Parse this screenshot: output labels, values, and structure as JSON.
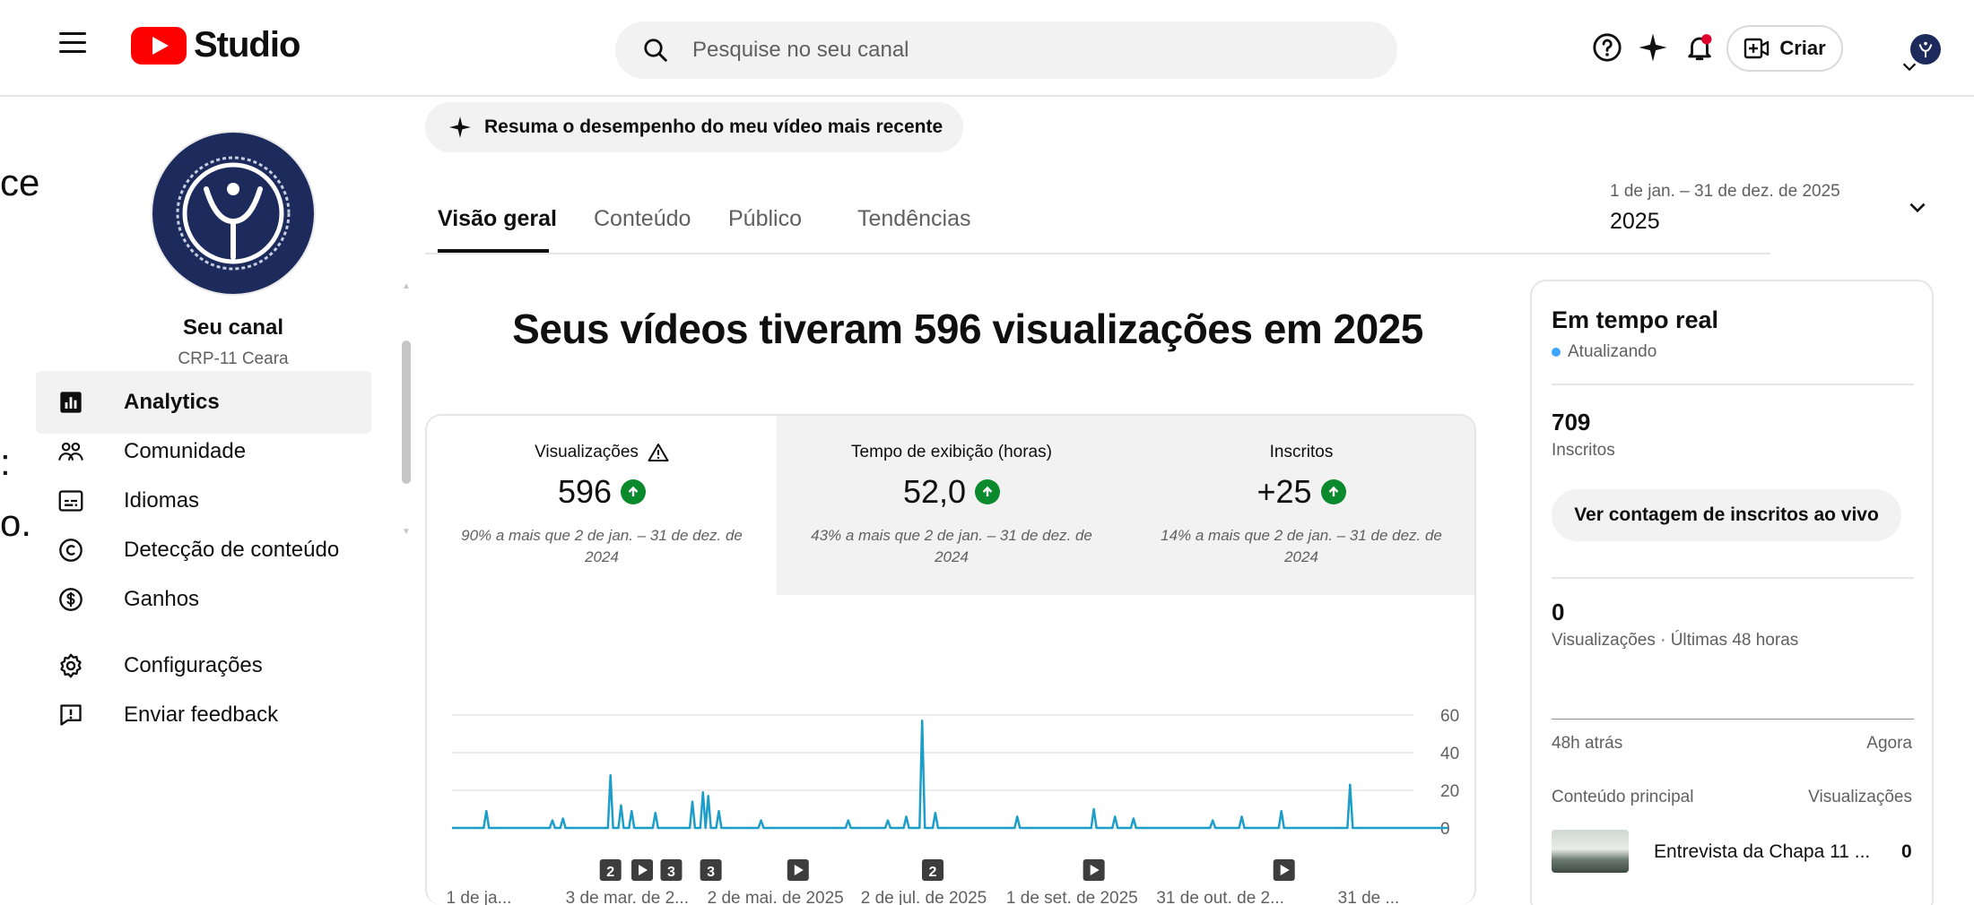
{
  "app": {
    "logo_text": "Studio",
    "search_placeholder": "Pesquise no seu canal",
    "create_label": "Criar"
  },
  "edge_fragments": [
    "ce",
    ":",
    "o."
  ],
  "sidebar": {
    "channel_title": "Seu canal",
    "channel_name": "CRP-11 Ceara",
    "items": [
      {
        "label": "Analytics",
        "icon": "analytics-icon",
        "active": true
      },
      {
        "label": "Comunidade",
        "icon": "community-icon"
      },
      {
        "label": "Idiomas",
        "icon": "subtitles-icon"
      },
      {
        "label": "Detecção de conteúdo",
        "icon": "copyright-icon"
      },
      {
        "label": "Ganhos",
        "icon": "earn-icon"
      },
      {
        "label": "Configurações",
        "icon": "gear-icon"
      },
      {
        "label": "Enviar feedback",
        "icon": "feedback-icon"
      }
    ]
  },
  "ai_chip": "Resuma o desempenho do meu vídeo mais recente",
  "tabs": [
    "Visão geral",
    "Conteúdo",
    "Público",
    "Tendências"
  ],
  "date_picker": {
    "range": "1 de jan. – 31 de dez. de 2025",
    "label": "2025"
  },
  "headline": "Seus vídeos tiveram 596 visualizações em 2025",
  "metrics": [
    {
      "label": "Visualizações",
      "value": "596",
      "note": "90% a mais que 2 de jan. – 31 de dez. de 2024"
    },
    {
      "label": "Tempo de exibição (horas)",
      "value": "52,0",
      "note": "43% a mais que 2 de jan. – 31 de dez. de 2024"
    },
    {
      "label": "Inscritos",
      "value": "+25",
      "note": "14% a mais que 2 de jan. – 31 de dez. de 2024"
    }
  ],
  "chart_data": {
    "type": "line",
    "series": [
      {
        "values": [
          0,
          0,
          0,
          0,
          0,
          0,
          0,
          0,
          0,
          0,
          0,
          0,
          0,
          0,
          0,
          0,
          0,
          0,
          0,
          0,
          0,
          0,
          0,
          0,
          0,
          0,
          0,
          0,
          0,
          0,
          0,
          0,
          0,
          0,
          0,
          0,
          0,
          0,
          0,
          0,
          0,
          0,
          0,
          0,
          0,
          0,
          0,
          0,
          0,
          0,
          0,
          0,
          0,
          0,
          0,
          0,
          0,
          0,
          0,
          0,
          0,
          0,
          0,
          0,
          0,
          0,
          0,
          0,
          0,
          0,
          0,
          0,
          0,
          0,
          0,
          0,
          0,
          0,
          0,
          0,
          0,
          0,
          0,
          0,
          0,
          0,
          0,
          0,
          0,
          0,
          0,
          0,
          0,
          0,
          0,
          0,
          0,
          0,
          0,
          0,
          0,
          0,
          0,
          0,
          0,
          0,
          0,
          0,
          0,
          0,
          0,
          0,
          0,
          0,
          0,
          0,
          0,
          0,
          0,
          0,
          0,
          0,
          0,
          0,
          0,
          0,
          0,
          0,
          0,
          0,
          0,
          0,
          0,
          0,
          0,
          0,
          0,
          0,
          0,
          0,
          0,
          0,
          0,
          0,
          0,
          0,
          0,
          0,
          0,
          0,
          0,
          0,
          0,
          0,
          0,
          0,
          0,
          0,
          0,
          0,
          0,
          0,
          0,
          0,
          0,
          0,
          0,
          0,
          0,
          0,
          0,
          0,
          0,
          0,
          0,
          0,
          0,
          0,
          0,
          0,
          0,
          0,
          0,
          0,
          0,
          0,
          0,
          0,
          0,
          0,
          0,
          0,
          0,
          0,
          0,
          0,
          0,
          0,
          0,
          0,
          0,
          0,
          0,
          0,
          0,
          0,
          0,
          0,
          0,
          0,
          0,
          0,
          0,
          0,
          0,
          0,
          0,
          0,
          0,
          0,
          0,
          0,
          0,
          0,
          0,
          0,
          0,
          0,
          0,
          0,
          0,
          0,
          0,
          0,
          0,
          0,
          0,
          0,
          0,
          0,
          0,
          0,
          0,
          0,
          0,
          0,
          0,
          0,
          0,
          0,
          0,
          0,
          0,
          0,
          0,
          0,
          0,
          0,
          0,
          0,
          0,
          0,
          0,
          0,
          0,
          0,
          0,
          0,
          0,
          0,
          0,
          0,
          0,
          0,
          0,
          0,
          0,
          0,
          0,
          0,
          0,
          0,
          0,
          0,
          0,
          0,
          0,
          0,
          0,
          0,
          0,
          0,
          0,
          0,
          0,
          0,
          0,
          0,
          0,
          0,
          0,
          0,
          0,
          0,
          0,
          0,
          0,
          0,
          0,
          0,
          0,
          0,
          0,
          0,
          0,
          0,
          0,
          0,
          0,
          0,
          0,
          0,
          0,
          0,
          0,
          0,
          0,
          0,
          0,
          0,
          0,
          0,
          0,
          0,
          0,
          0,
          0,
          0,
          0,
          0,
          0,
          0,
          0,
          0,
          0,
          0,
          0,
          0,
          0,
          0,
          0,
          0,
          0,
          0,
          0,
          0,
          0,
          0,
          0,
          0,
          0,
          0,
          0,
          0,
          0,
          0,
          0,
          0,
          0,
          0,
          0,
          0,
          0,
          0,
          0,
          0,
          0,
          0
        ]
      }
    ],
    "x_labels": [
      "1 de ja...",
      "3 de mar. de 2...",
      "2 de mai. de 2025",
      "2 de jul. de 2025",
      "1 de set. de 2025",
      "31 de out. de 2...",
      "31 de ..."
    ],
    "ylim": [
      0,
      60
    ],
    "yticks": [
      0,
      20,
      40,
      60
    ],
    "grid": true,
    "markers": [
      {
        "day": 60,
        "label": "2"
      },
      {
        "day": 72,
        "label": "▶"
      },
      {
        "day": 83,
        "label": "3"
      },
      {
        "day": 98,
        "label": "3"
      },
      {
        "day": 131,
        "label": "▶"
      },
      {
        "day": 182,
        "label": "2"
      },
      {
        "day": 243,
        "label": "▶"
      },
      {
        "day": 315,
        "label": "▶"
      }
    ],
    "spikes": [
      {
        "day": 13,
        "value": 9
      },
      {
        "day": 38,
        "value": 4
      },
      {
        "day": 42,
        "value": 5
      },
      {
        "day": 60,
        "value": 28
      },
      {
        "day": 64,
        "value": 12
      },
      {
        "day": 68,
        "value": 9
      },
      {
        "day": 77,
        "value": 8
      },
      {
        "day": 91,
        "value": 14
      },
      {
        "day": 95,
        "value": 19
      },
      {
        "day": 97,
        "value": 17
      },
      {
        "day": 101,
        "value": 9
      },
      {
        "day": 117,
        "value": 4
      },
      {
        "day": 150,
        "value": 4
      },
      {
        "day": 165,
        "value": 4
      },
      {
        "day": 172,
        "value": 6
      },
      {
        "day": 178,
        "value": 57
      },
      {
        "day": 183,
        "value": 8
      },
      {
        "day": 214,
        "value": 6
      },
      {
        "day": 243,
        "value": 10
      },
      {
        "day": 251,
        "value": 6
      },
      {
        "day": 258,
        "value": 5
      },
      {
        "day": 288,
        "value": 4
      },
      {
        "day": 299,
        "value": 6
      },
      {
        "day": 314,
        "value": 9
      },
      {
        "day": 340,
        "value": 23
      }
    ]
  },
  "realtime": {
    "title": "Em tempo real",
    "status": "Atualizando",
    "subscribers": "709",
    "subscribers_label": "Inscritos",
    "live_count_button": "Ver contagem de inscritos ao vivo",
    "views": "0",
    "views_label": "Visualizações · Últimas 48 horas",
    "axis_start": "48h atrás",
    "axis_end": "Agora",
    "top_content_label": "Conteúdo principal",
    "views_column_label": "Visualizações",
    "top_video": {
      "title": "Entrevista da Chapa 11 ...",
      "views": "0"
    }
  },
  "colors": {
    "accent": "#3ea6ff",
    "line": "#1d9ec9",
    "brand": "#ff0000",
    "up": "#0a8a2c"
  }
}
